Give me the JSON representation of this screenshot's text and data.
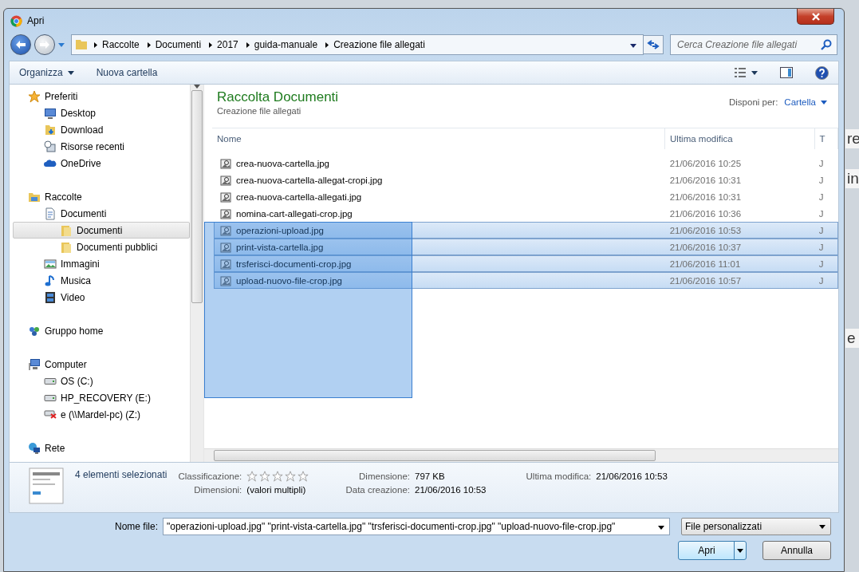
{
  "window": {
    "title": "Apri"
  },
  "background_texts": [
    "re",
    "in",
    "e"
  ],
  "address": {
    "crumbs": [
      "Raccolte",
      "Documenti",
      "2017",
      "guida-manuale",
      "Creazione file allegati"
    ]
  },
  "search": {
    "placeholder": "Cerca Creazione file allegati"
  },
  "toolbar": {
    "buttons": [
      "Organizza",
      "Nuova cartella"
    ]
  },
  "sidebar": {
    "groups": [
      {
        "label": "Preferiti",
        "kind": "star",
        "selected": false,
        "children": [
          {
            "label": "Desktop",
            "kind": "desktop",
            "selected": false
          },
          {
            "label": "Download",
            "kind": "download",
            "selected": false
          },
          {
            "label": "Risorse recenti",
            "kind": "recent",
            "selected": false
          },
          {
            "label": "OneDrive",
            "kind": "cloud",
            "selected": false
          }
        ]
      },
      {
        "label": "Raccolte",
        "kind": "library",
        "selected": false,
        "children": [
          {
            "label": "Documenti",
            "kind": "doc",
            "selected": false,
            "children": [
              {
                "label": "Documenti",
                "kind": "folder",
                "selected": true
              },
              {
                "label": "Documenti pubblici",
                "kind": "folder",
                "selected": false
              }
            ]
          },
          {
            "label": "Immagini",
            "kind": "image",
            "selected": false
          },
          {
            "label": "Musica",
            "kind": "music",
            "selected": false
          },
          {
            "label": "Video",
            "kind": "video",
            "selected": false
          }
        ]
      },
      {
        "label": "Gruppo home",
        "kind": "homegroup",
        "selected": false
      },
      {
        "label": "Computer",
        "kind": "computer",
        "selected": false,
        "children": [
          {
            "label": "OS (C:)",
            "kind": "drive",
            "selected": false
          },
          {
            "label": "HP_RECOVERY (E:)",
            "kind": "drive",
            "selected": false
          },
          {
            "label": "e (\\\\Mardel-pc) (Z:)",
            "kind": "netdrive",
            "selected": false
          }
        ]
      },
      {
        "label": "Rete",
        "kind": "network",
        "selected": false
      }
    ]
  },
  "library": {
    "title": "Raccolta Documenti",
    "subtitle": "Creazione file allegati",
    "arrange_label": "Disponi per:",
    "arrange_value": "Cartella"
  },
  "table": {
    "columns": [
      "Nome",
      "Ultima modifica",
      "T"
    ],
    "rows": [
      {
        "name": "crea-nuova-cartella.jpg",
        "modified": "21/06/2016 10:25",
        "column_3": "J",
        "selected": false
      },
      {
        "name": "crea-nuova-cartella-allegat-cropi.jpg",
        "modified": "21/06/2016 10:31",
        "column_3": "J",
        "selected": false
      },
      {
        "name": "crea-nuova-cartella-allegati.jpg",
        "modified": "21/06/2016 10:31",
        "column_3": "J",
        "selected": false
      },
      {
        "name": "nomina-cart-allegati-crop.jpg",
        "modified": "21/06/2016 10:36",
        "column_3": "J",
        "selected": false
      },
      {
        "name": "operazioni-upload.jpg",
        "modified": "21/06/2016 10:53",
        "column_3": "J",
        "selected": true
      },
      {
        "name": "print-vista-cartella.jpg",
        "modified": "21/06/2016 10:37",
        "column_3": "J",
        "selected": true
      },
      {
        "name": "trsferisci-documenti-crop.jpg",
        "modified": "21/06/2016 11:01",
        "column_3": "J",
        "selected": true
      },
      {
        "name": "upload-nuovo-file-crop.jpg",
        "modified": "21/06/2016 10:57",
        "column_3": "J",
        "selected": true
      }
    ]
  },
  "details": {
    "count": "4 elementi selezionati",
    "rating_label": "Classificazione:",
    "stars": 0,
    "fields": [
      {
        "label": "Dimensioni:",
        "value": "(valori multipli)"
      },
      {
        "label": "Dimensione:",
        "value": "797 KB"
      },
      {
        "label": "Data creazione:",
        "value": "21/06/2016 10:53"
      },
      {
        "label": "Ultima modifica:",
        "value": "21/06/2016 10:53"
      }
    ]
  },
  "filename": {
    "label": "Nome file:",
    "value": "\"operazioni-upload.jpg\" \"print-vista-cartella.jpg\" \"trsferisci-documenti-crop.jpg\" \"upload-nuovo-file-crop.jpg\""
  },
  "filter": {
    "value": "File personalizzati"
  },
  "buttons": [
    "Apri",
    "Annulla"
  ]
}
